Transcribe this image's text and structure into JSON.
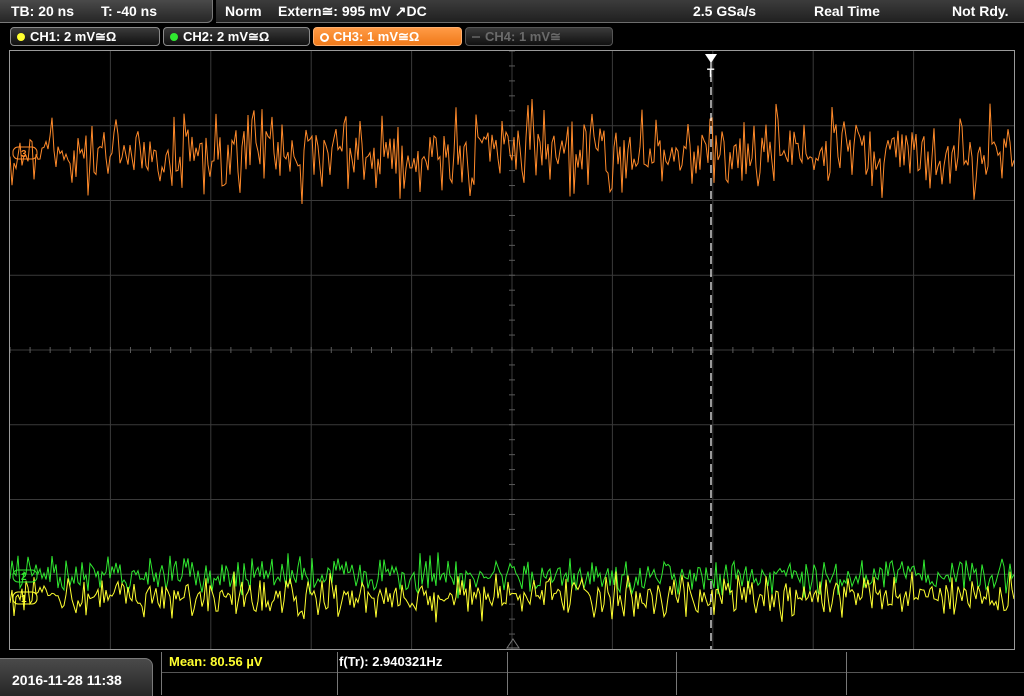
{
  "header": {
    "timebase": "TB: 20 ns",
    "trigger_time": "T: -40 ns",
    "mode": "Norm",
    "trigger_source": "Extern≅: 995 mV ↗DC",
    "sample_rate": "2.5 GSa/s",
    "acquisition": "Real Time",
    "status": "Not Rdy."
  },
  "channels": [
    {
      "label": "CH1: 2 mV≅Ω",
      "color": "#ffff30",
      "state": "on"
    },
    {
      "label": "CH2: 2 mV≅Ω",
      "color": "#30e830",
      "state": "on"
    },
    {
      "label": "CH3: 1 mV≅Ω",
      "color": "#ff8a2a",
      "state": "selected"
    },
    {
      "label": "CH4: 1 mV≅",
      "color": "#6a6a6a",
      "state": "off"
    }
  ],
  "display": {
    "trigger_marker": "T",
    "ch3_marker": "3",
    "ch2_marker": "2",
    "ch1_marker": "1",
    "colors": {
      "ch1": "#ffff30",
      "ch2": "#30e830",
      "ch3": "#ff8a2a",
      "grid": "#444444"
    }
  },
  "footer": {
    "datetime": "2016-11-28 11:38",
    "mean_label": "Mean: 80.56 µV",
    "freq_label": "f(Tr): 2.940321Hz"
  }
}
